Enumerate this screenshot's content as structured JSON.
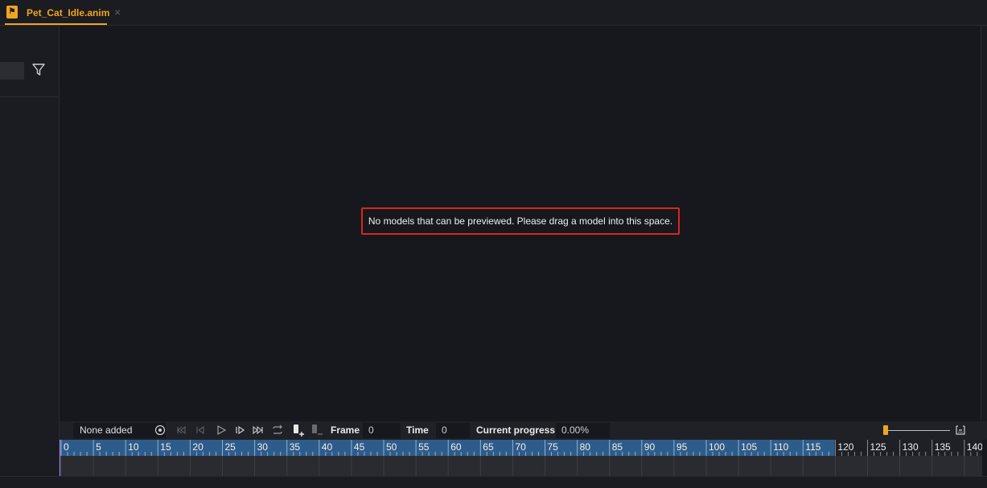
{
  "tab": {
    "label": "Pet_Cat_Idle.anim",
    "icon": "animation-file-icon",
    "close_icon": "×"
  },
  "left_panel": {
    "filter_icon": "filter-icon"
  },
  "viewport": {
    "message": "No models that can be previewed. Please drag a model into this space."
  },
  "controls": {
    "model_select": "None added",
    "frame_label": "Frame",
    "frame_value": "0",
    "time_label": "Time",
    "time_value": "0",
    "progress_label": "Current progress",
    "progress_value": "0.00%",
    "zoom_level": 0.04
  },
  "timeline": {
    "ticks": [
      "0",
      "5",
      "10",
      "15",
      "20",
      "25",
      "30",
      "35",
      "40",
      "45",
      "50",
      "55",
      "60",
      "65",
      "70",
      "75",
      "80",
      "85",
      "90",
      "95",
      "100",
      "105",
      "110",
      "115",
      "120",
      "125",
      "130",
      "135",
      "140"
    ],
    "active_end_frame": 120
  },
  "colors": {
    "accent": "#f1a51d",
    "alert_border": "#d8261e",
    "ruler_active": "#2e5c8a",
    "playhead": "#b07cff"
  }
}
